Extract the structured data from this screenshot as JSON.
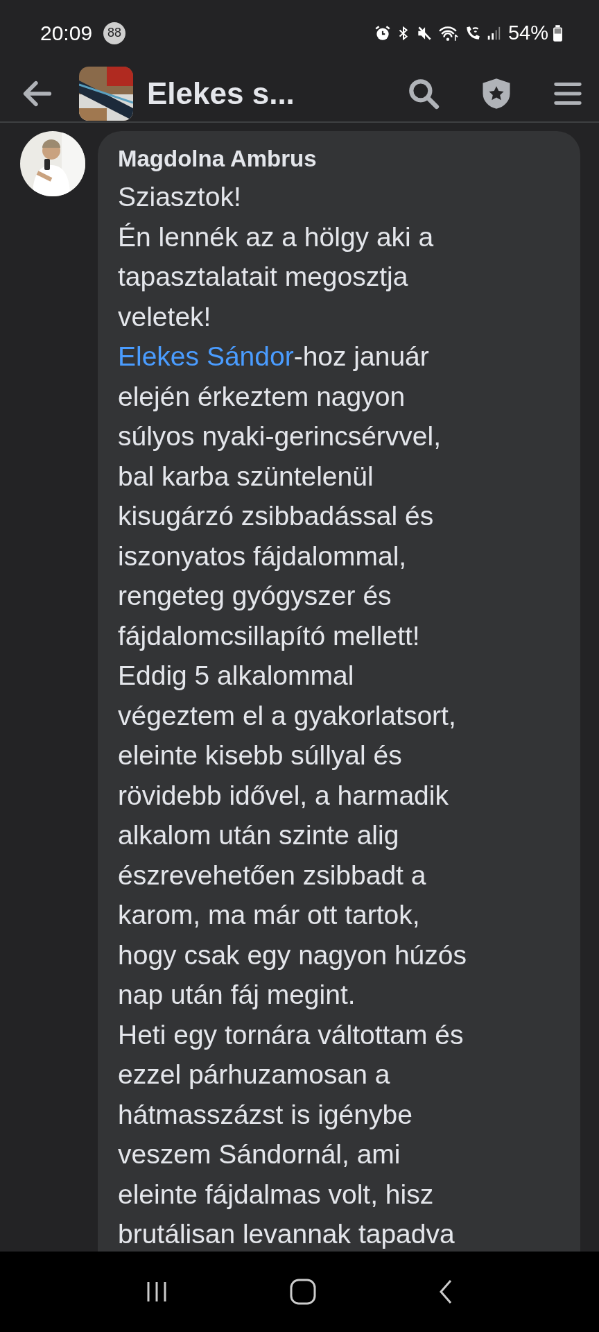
{
  "status_bar": {
    "time": "20:09",
    "badge": "88",
    "battery": "54%"
  },
  "header": {
    "title": "Elekes s..."
  },
  "comment": {
    "author": "Magdolna Ambrus",
    "paragraphs": [
      {
        "text": "Sziasztok!"
      },
      {
        "text": "Én lennék az a hölgy aki a\ntapasztalatait megosztja\nveletek!"
      },
      {
        "link": "Elekes Sándor",
        "text": "-hoz január\nelején érkeztem nagyon\nsúlyos nyaki-gerincsérvvel,\nbal karba szüntelenül\nkisugárzó zsibbadással és\niszonyatos fájdalommal,\nrengeteg gyógyszer és\nfájdalomcsillapító mellett!"
      },
      {
        "text": "Eddig 5 alkalommal\nvégeztem el a gyakorlatsort,\neleinte kisebb súllyal és\nrövidebb idővel, a harmadik\nalkalom után szinte alig\nészrevehetően zsibbadt a\nkarom, ma már ott tartok,\nhogy csak egy nagyon húzós\nnap után fáj megint."
      },
      {
        "text": "Heti egy tornára váltottam és\nezzel párhuzamosan a\nhátmasszázst is igénybe\nveszem Sándornál, ami\neleinte fájdalmas volt, hisz\nbrutálisan levannak tapadva"
      }
    ]
  }
}
